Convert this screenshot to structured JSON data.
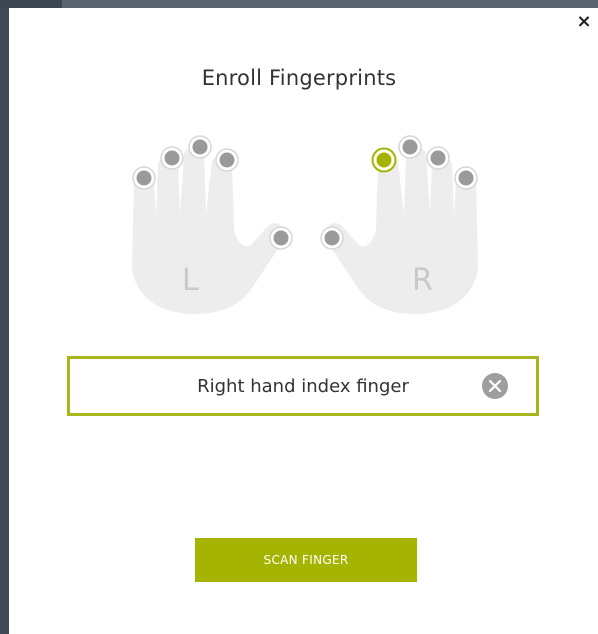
{
  "dialog": {
    "title": "Enroll Fingerprints",
    "close_icon": "close-icon",
    "close_glyph": "×"
  },
  "hands": {
    "left": {
      "letter": "L",
      "fingers": [
        "little",
        "ring",
        "middle",
        "index",
        "thumb"
      ]
    },
    "right": {
      "letter": "R",
      "fingers": [
        "thumb",
        "index",
        "middle",
        "ring",
        "little"
      ]
    },
    "selected": "right-index",
    "colors": {
      "hand_fill": "#ededed",
      "dot_default": "#9a9a9a",
      "dot_selected": "#a4b400",
      "letter": "#c9c9c9"
    }
  },
  "selection_field": {
    "label": "Right hand index finger",
    "clear_icon": "clear-icon",
    "border_color": "#a8b61d"
  },
  "actions": {
    "scan_label": "SCAN FINGER",
    "scan_color": "#a4b400"
  }
}
